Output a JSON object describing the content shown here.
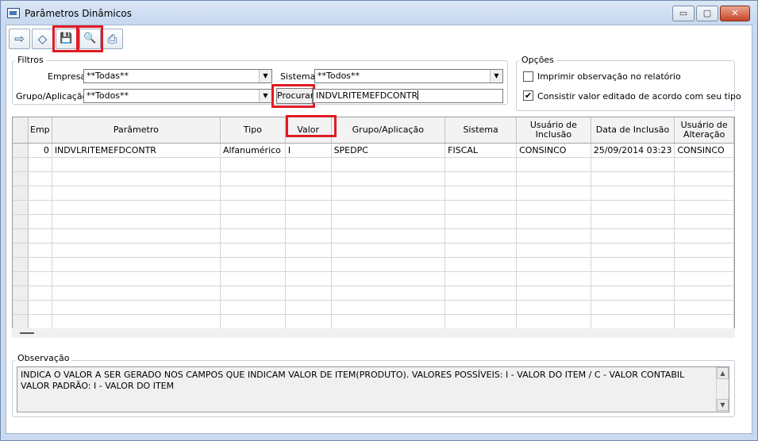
{
  "window": {
    "title": "Parâmetros Dinâmicos",
    "minimize": "▭",
    "maximize": "▢",
    "close": "✕"
  },
  "toolbar": [
    {
      "name": "exit-icon",
      "glyph": "⇨"
    },
    {
      "name": "eraser-icon",
      "glyph": "◇"
    },
    {
      "name": "save-icon",
      "glyph": "💾"
    },
    {
      "name": "search-icon",
      "glyph": "🔍"
    },
    {
      "name": "print-icon",
      "glyph": "⎙"
    }
  ],
  "filtros": {
    "legend": "Filtros",
    "empresa_label": "Empresa",
    "empresa_value": "**Todas**",
    "sistema_label": "Sistema",
    "sistema_value": "**Todos**",
    "grupo_label": "Grupo/Aplicação",
    "grupo_value": "**Todos**",
    "procurar_label": "Procurar",
    "procurar_value": "INDVLRITEMEFDCONTR"
  },
  "opcoes": {
    "legend": "Opções",
    "opt1_label": "Imprimir observação no relatório",
    "opt1_checked": false,
    "opt2_label": "Consistir valor editado de acordo com seu tipo",
    "opt2_checked": true
  },
  "grid": {
    "columns": [
      "Emp",
      "Parâmetro",
      "Tipo",
      "Valor",
      "Grupo/Aplicação",
      "Sistema",
      "Usuário de Inclusão",
      "Data de Inclusão",
      "Usuário de Alteração"
    ],
    "rows": [
      [
        "0",
        "INDVLRITEMEFDCONTR",
        "Alfanumérico",
        "I",
        "SPEDPC",
        "FISCAL",
        "CONSINCO",
        "25/09/2014 03:23",
        "CONSINCO"
      ]
    ]
  },
  "observacao": {
    "legend": "Observação",
    "text": "INDICA O VALOR A SER GERADO NOS CAMPOS QUE INDICAM VALOR DE ITEM(PRODUTO). VALORES POSSÍVEIS: I - VALOR DO ITEM / C - VALOR CONTABIL VALOR PADRÃO: I - VALOR DO ITEM"
  },
  "colors": {
    "highlight": "#e01b24",
    "titlebar": "#c6d8ef"
  }
}
